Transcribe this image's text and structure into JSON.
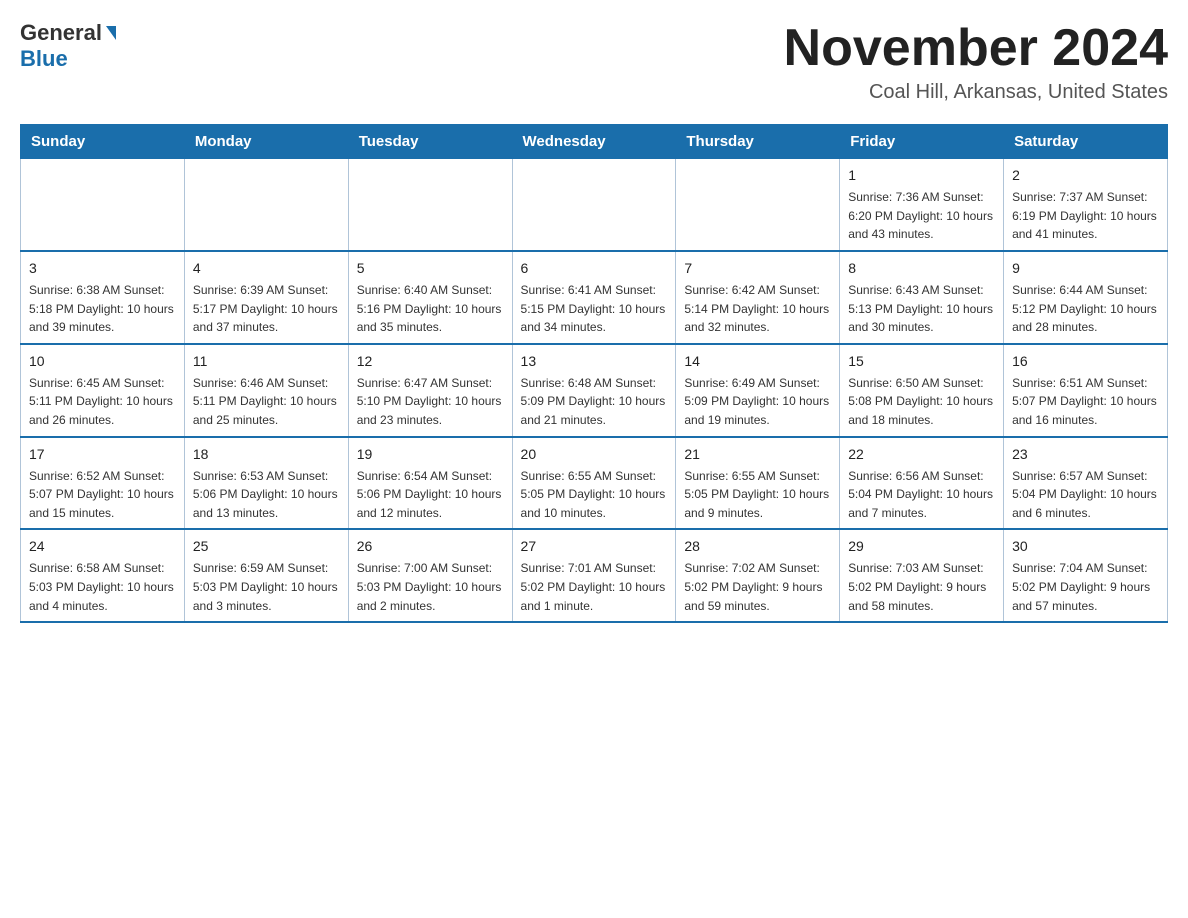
{
  "header": {
    "logo_general": "General",
    "logo_blue": "Blue",
    "month_title": "November 2024",
    "subtitle": "Coal Hill, Arkansas, United States"
  },
  "calendar": {
    "days_of_week": [
      "Sunday",
      "Monday",
      "Tuesday",
      "Wednesday",
      "Thursday",
      "Friday",
      "Saturday"
    ],
    "weeks": [
      [
        {
          "day": "",
          "info": ""
        },
        {
          "day": "",
          "info": ""
        },
        {
          "day": "",
          "info": ""
        },
        {
          "day": "",
          "info": ""
        },
        {
          "day": "",
          "info": ""
        },
        {
          "day": "1",
          "info": "Sunrise: 7:36 AM\nSunset: 6:20 PM\nDaylight: 10 hours and 43 minutes."
        },
        {
          "day": "2",
          "info": "Sunrise: 7:37 AM\nSunset: 6:19 PM\nDaylight: 10 hours and 41 minutes."
        }
      ],
      [
        {
          "day": "3",
          "info": "Sunrise: 6:38 AM\nSunset: 5:18 PM\nDaylight: 10 hours and 39 minutes."
        },
        {
          "day": "4",
          "info": "Sunrise: 6:39 AM\nSunset: 5:17 PM\nDaylight: 10 hours and 37 minutes."
        },
        {
          "day": "5",
          "info": "Sunrise: 6:40 AM\nSunset: 5:16 PM\nDaylight: 10 hours and 35 minutes."
        },
        {
          "day": "6",
          "info": "Sunrise: 6:41 AM\nSunset: 5:15 PM\nDaylight: 10 hours and 34 minutes."
        },
        {
          "day": "7",
          "info": "Sunrise: 6:42 AM\nSunset: 5:14 PM\nDaylight: 10 hours and 32 minutes."
        },
        {
          "day": "8",
          "info": "Sunrise: 6:43 AM\nSunset: 5:13 PM\nDaylight: 10 hours and 30 minutes."
        },
        {
          "day": "9",
          "info": "Sunrise: 6:44 AM\nSunset: 5:12 PM\nDaylight: 10 hours and 28 minutes."
        }
      ],
      [
        {
          "day": "10",
          "info": "Sunrise: 6:45 AM\nSunset: 5:11 PM\nDaylight: 10 hours and 26 minutes."
        },
        {
          "day": "11",
          "info": "Sunrise: 6:46 AM\nSunset: 5:11 PM\nDaylight: 10 hours and 25 minutes."
        },
        {
          "day": "12",
          "info": "Sunrise: 6:47 AM\nSunset: 5:10 PM\nDaylight: 10 hours and 23 minutes."
        },
        {
          "day": "13",
          "info": "Sunrise: 6:48 AM\nSunset: 5:09 PM\nDaylight: 10 hours and 21 minutes."
        },
        {
          "day": "14",
          "info": "Sunrise: 6:49 AM\nSunset: 5:09 PM\nDaylight: 10 hours and 19 minutes."
        },
        {
          "day": "15",
          "info": "Sunrise: 6:50 AM\nSunset: 5:08 PM\nDaylight: 10 hours and 18 minutes."
        },
        {
          "day": "16",
          "info": "Sunrise: 6:51 AM\nSunset: 5:07 PM\nDaylight: 10 hours and 16 minutes."
        }
      ],
      [
        {
          "day": "17",
          "info": "Sunrise: 6:52 AM\nSunset: 5:07 PM\nDaylight: 10 hours and 15 minutes."
        },
        {
          "day": "18",
          "info": "Sunrise: 6:53 AM\nSunset: 5:06 PM\nDaylight: 10 hours and 13 minutes."
        },
        {
          "day": "19",
          "info": "Sunrise: 6:54 AM\nSunset: 5:06 PM\nDaylight: 10 hours and 12 minutes."
        },
        {
          "day": "20",
          "info": "Sunrise: 6:55 AM\nSunset: 5:05 PM\nDaylight: 10 hours and 10 minutes."
        },
        {
          "day": "21",
          "info": "Sunrise: 6:55 AM\nSunset: 5:05 PM\nDaylight: 10 hours and 9 minutes."
        },
        {
          "day": "22",
          "info": "Sunrise: 6:56 AM\nSunset: 5:04 PM\nDaylight: 10 hours and 7 minutes."
        },
        {
          "day": "23",
          "info": "Sunrise: 6:57 AM\nSunset: 5:04 PM\nDaylight: 10 hours and 6 minutes."
        }
      ],
      [
        {
          "day": "24",
          "info": "Sunrise: 6:58 AM\nSunset: 5:03 PM\nDaylight: 10 hours and 4 minutes."
        },
        {
          "day": "25",
          "info": "Sunrise: 6:59 AM\nSunset: 5:03 PM\nDaylight: 10 hours and 3 minutes."
        },
        {
          "day": "26",
          "info": "Sunrise: 7:00 AM\nSunset: 5:03 PM\nDaylight: 10 hours and 2 minutes."
        },
        {
          "day": "27",
          "info": "Sunrise: 7:01 AM\nSunset: 5:02 PM\nDaylight: 10 hours and 1 minute."
        },
        {
          "day": "28",
          "info": "Sunrise: 7:02 AM\nSunset: 5:02 PM\nDaylight: 9 hours and 59 minutes."
        },
        {
          "day": "29",
          "info": "Sunrise: 7:03 AM\nSunset: 5:02 PM\nDaylight: 9 hours and 58 minutes."
        },
        {
          "day": "30",
          "info": "Sunrise: 7:04 AM\nSunset: 5:02 PM\nDaylight: 9 hours and 57 minutes."
        }
      ]
    ]
  }
}
